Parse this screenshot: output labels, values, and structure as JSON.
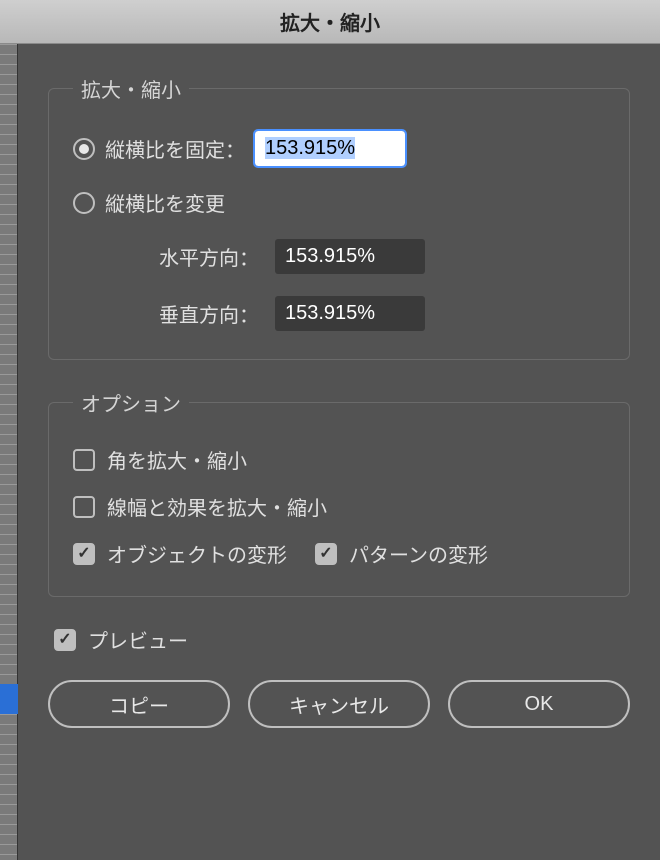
{
  "title": "拡大・縮小",
  "scale_group": {
    "legend": "拡大・縮小",
    "uniform_label": "縦横比を固定：",
    "uniform_value": "153.915%",
    "nonuniform_label": "縦横比を変更",
    "h_label": "水平方向：",
    "h_value": "153.915%",
    "v_label": "垂直方向：",
    "v_value": "153.915%",
    "selected": "uniform"
  },
  "options": {
    "legend": "オプション",
    "scale_corners": {
      "label": "角を拡大・縮小",
      "checked": false
    },
    "scale_strokes": {
      "label": "線幅と効果を拡大・縮小",
      "checked": false
    },
    "transform_objects": {
      "label": "オブジェクトの変形",
      "checked": true
    },
    "transform_patterns": {
      "label": "パターンの変形",
      "checked": true
    }
  },
  "preview": {
    "label": "プレビュー",
    "checked": true
  },
  "buttons": {
    "copy": "コピー",
    "cancel": "キャンセル",
    "ok": "OK"
  }
}
